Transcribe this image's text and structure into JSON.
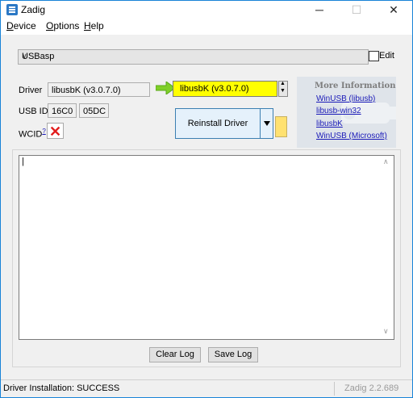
{
  "window": {
    "title": "Zadig",
    "minimize_glyph": "─",
    "maximize_glyph": "☐",
    "close_glyph": "✕"
  },
  "menu": {
    "device": "Device",
    "options": "Options",
    "help": "Help"
  },
  "device_select": {
    "value": "USBasp",
    "arrow_glyph": "∨",
    "edit_label": "Edit",
    "edit_checked": false
  },
  "driver": {
    "label": "Driver",
    "current": "libusbK (v3.0.7.0)",
    "target": "libusbK (v3.0.7.0)"
  },
  "usb_id": {
    "label": "USB ID",
    "vid": "16C0",
    "pid": "05DC"
  },
  "wcid": {
    "label": "WCID",
    "superscript": "?",
    "status_glyph": "✕"
  },
  "install_button": {
    "label": "Reinstall Driver"
  },
  "more_info": {
    "title": "More Information",
    "links": [
      "WinUSB (libusb)",
      "libusb-win32",
      "libusbK",
      "WinUSB (Microsoft)"
    ]
  },
  "log": {
    "content": "|",
    "clear_label": "Clear Log",
    "save_label": "Save Log"
  },
  "status": {
    "message": "Driver Installation: SUCCESS",
    "version": "Zadig 2.2.689"
  },
  "colors": {
    "window_border": "#1883d7",
    "target_highlight": "#ffff00",
    "arrow_green": "#7fcf28",
    "wcid_red": "#e21d1d",
    "link_blue": "#1a1ab8"
  }
}
